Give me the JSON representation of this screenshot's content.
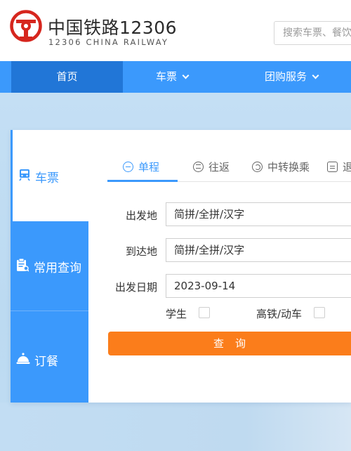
{
  "brand": {
    "title": "中国铁路12306",
    "subtitle": "12306 CHINA RAILWAY",
    "primary_color": "#3b99fc",
    "logo_color": "#d6261e"
  },
  "search": {
    "placeholder": "搜索车票、餐饮"
  },
  "nav": {
    "items": [
      {
        "label": "首页",
        "active": true
      },
      {
        "label": "车票",
        "has_dropdown": true
      },
      {
        "label": "团购服务",
        "has_dropdown": true
      }
    ]
  },
  "sidebar": {
    "items": [
      {
        "label": "车票",
        "icon": "train-icon",
        "active": true
      },
      {
        "label": "常用查询",
        "icon": "clipboard-icon"
      },
      {
        "label": "订餐",
        "icon": "food-cloche-icon"
      }
    ]
  },
  "tabs": {
    "items": [
      {
        "label": "单程",
        "active": true
      },
      {
        "label": "往返"
      },
      {
        "label": "中转换乘"
      },
      {
        "label": "退"
      }
    ]
  },
  "form": {
    "from_label": "出发地",
    "from_value": "简拼/全拼/汉字",
    "to_label": "到达地",
    "to_value": "简拼/全拼/汉字",
    "date_label": "出发日期",
    "date_value": "2023-09-14",
    "student_label": "学生",
    "student_checked": false,
    "highspeed_label": "高铁/动车",
    "highspeed_checked": false,
    "submit_label": "查询",
    "submit_color": "#fb7d1b"
  }
}
